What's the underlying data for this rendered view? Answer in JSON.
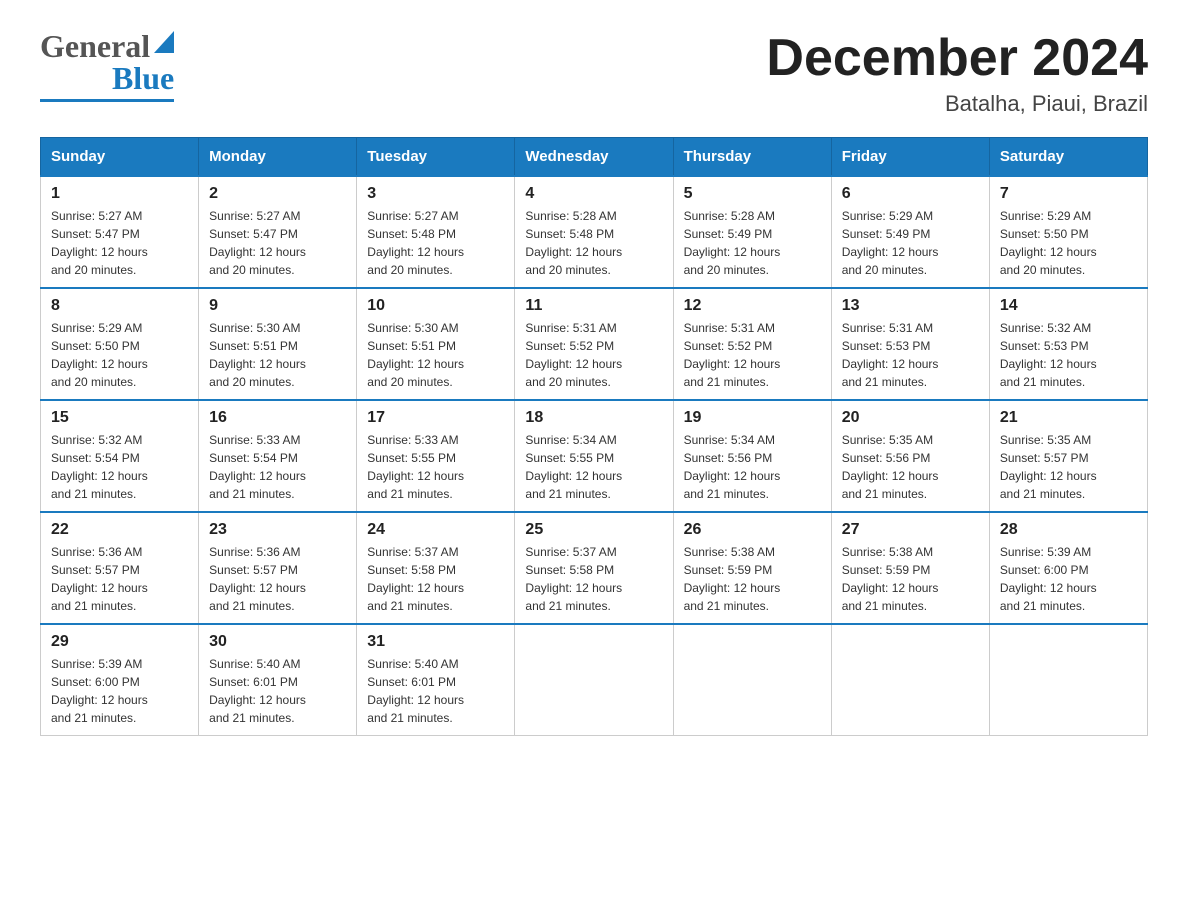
{
  "header": {
    "title": "December 2024",
    "subtitle": "Batalha, Piaui, Brazil",
    "logo_general": "General",
    "logo_blue": "Blue"
  },
  "days_of_week": [
    "Sunday",
    "Monday",
    "Tuesday",
    "Wednesday",
    "Thursday",
    "Friday",
    "Saturday"
  ],
  "weeks": [
    {
      "days": [
        {
          "num": "1",
          "sunrise": "5:27 AM",
          "sunset": "5:47 PM",
          "daylight": "12 hours and 20 minutes."
        },
        {
          "num": "2",
          "sunrise": "5:27 AM",
          "sunset": "5:47 PM",
          "daylight": "12 hours and 20 minutes."
        },
        {
          "num": "3",
          "sunrise": "5:27 AM",
          "sunset": "5:48 PM",
          "daylight": "12 hours and 20 minutes."
        },
        {
          "num": "4",
          "sunrise": "5:28 AM",
          "sunset": "5:48 PM",
          "daylight": "12 hours and 20 minutes."
        },
        {
          "num": "5",
          "sunrise": "5:28 AM",
          "sunset": "5:49 PM",
          "daylight": "12 hours and 20 minutes."
        },
        {
          "num": "6",
          "sunrise": "5:29 AM",
          "sunset": "5:49 PM",
          "daylight": "12 hours and 20 minutes."
        },
        {
          "num": "7",
          "sunrise": "5:29 AM",
          "sunset": "5:50 PM",
          "daylight": "12 hours and 20 minutes."
        }
      ]
    },
    {
      "days": [
        {
          "num": "8",
          "sunrise": "5:29 AM",
          "sunset": "5:50 PM",
          "daylight": "12 hours and 20 minutes."
        },
        {
          "num": "9",
          "sunrise": "5:30 AM",
          "sunset": "5:51 PM",
          "daylight": "12 hours and 20 minutes."
        },
        {
          "num": "10",
          "sunrise": "5:30 AM",
          "sunset": "5:51 PM",
          "daylight": "12 hours and 20 minutes."
        },
        {
          "num": "11",
          "sunrise": "5:31 AM",
          "sunset": "5:52 PM",
          "daylight": "12 hours and 20 minutes."
        },
        {
          "num": "12",
          "sunrise": "5:31 AM",
          "sunset": "5:52 PM",
          "daylight": "12 hours and 21 minutes."
        },
        {
          "num": "13",
          "sunrise": "5:31 AM",
          "sunset": "5:53 PM",
          "daylight": "12 hours and 21 minutes."
        },
        {
          "num": "14",
          "sunrise": "5:32 AM",
          "sunset": "5:53 PM",
          "daylight": "12 hours and 21 minutes."
        }
      ]
    },
    {
      "days": [
        {
          "num": "15",
          "sunrise": "5:32 AM",
          "sunset": "5:54 PM",
          "daylight": "12 hours and 21 minutes."
        },
        {
          "num": "16",
          "sunrise": "5:33 AM",
          "sunset": "5:54 PM",
          "daylight": "12 hours and 21 minutes."
        },
        {
          "num": "17",
          "sunrise": "5:33 AM",
          "sunset": "5:55 PM",
          "daylight": "12 hours and 21 minutes."
        },
        {
          "num": "18",
          "sunrise": "5:34 AM",
          "sunset": "5:55 PM",
          "daylight": "12 hours and 21 minutes."
        },
        {
          "num": "19",
          "sunrise": "5:34 AM",
          "sunset": "5:56 PM",
          "daylight": "12 hours and 21 minutes."
        },
        {
          "num": "20",
          "sunrise": "5:35 AM",
          "sunset": "5:56 PM",
          "daylight": "12 hours and 21 minutes."
        },
        {
          "num": "21",
          "sunrise": "5:35 AM",
          "sunset": "5:57 PM",
          "daylight": "12 hours and 21 minutes."
        }
      ]
    },
    {
      "days": [
        {
          "num": "22",
          "sunrise": "5:36 AM",
          "sunset": "5:57 PM",
          "daylight": "12 hours and 21 minutes."
        },
        {
          "num": "23",
          "sunrise": "5:36 AM",
          "sunset": "5:57 PM",
          "daylight": "12 hours and 21 minutes."
        },
        {
          "num": "24",
          "sunrise": "5:37 AM",
          "sunset": "5:58 PM",
          "daylight": "12 hours and 21 minutes."
        },
        {
          "num": "25",
          "sunrise": "5:37 AM",
          "sunset": "5:58 PM",
          "daylight": "12 hours and 21 minutes."
        },
        {
          "num": "26",
          "sunrise": "5:38 AM",
          "sunset": "5:59 PM",
          "daylight": "12 hours and 21 minutes."
        },
        {
          "num": "27",
          "sunrise": "5:38 AM",
          "sunset": "5:59 PM",
          "daylight": "12 hours and 21 minutes."
        },
        {
          "num": "28",
          "sunrise": "5:39 AM",
          "sunset": "6:00 PM",
          "daylight": "12 hours and 21 minutes."
        }
      ]
    },
    {
      "days": [
        {
          "num": "29",
          "sunrise": "5:39 AM",
          "sunset": "6:00 PM",
          "daylight": "12 hours and 21 minutes."
        },
        {
          "num": "30",
          "sunrise": "5:40 AM",
          "sunset": "6:01 PM",
          "daylight": "12 hours and 21 minutes."
        },
        {
          "num": "31",
          "sunrise": "5:40 AM",
          "sunset": "6:01 PM",
          "daylight": "12 hours and 21 minutes."
        },
        null,
        null,
        null,
        null
      ]
    }
  ],
  "labels": {
    "sunrise_prefix": "Sunrise: ",
    "sunset_prefix": "Sunset: ",
    "daylight_prefix": "Daylight: "
  },
  "colors": {
    "header_bg": "#1a7abf",
    "header_text": "#ffffff",
    "border": "#bbbbbb",
    "week_border_top": "#1a7abf"
  }
}
